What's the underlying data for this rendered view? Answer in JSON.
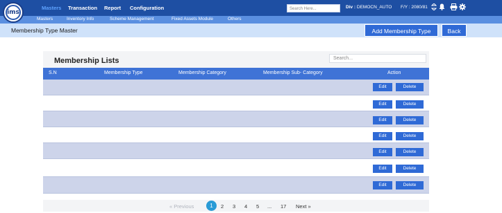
{
  "brand": {
    "logo_text": "ims"
  },
  "top_menu": [
    {
      "label": "Masters"
    },
    {
      "label": "Transaction"
    },
    {
      "label": "Report"
    },
    {
      "label": "Configuration"
    }
  ],
  "header": {
    "search_placeholder": "Search Here...",
    "div_label": "Div :",
    "div_value": "DEMOCN_AUTO",
    "fy_label": "F/Y :",
    "fy_value": "2080/81"
  },
  "sub_menu": [
    {
      "label": "Masters"
    },
    {
      "label": "Inventory Info"
    },
    {
      "label": "Scheme Management"
    },
    {
      "label": "Fixed Assets Module"
    },
    {
      "label": "Others"
    }
  ],
  "page": {
    "title": "Membership Type Master",
    "add_button": "Add Membership Type",
    "back_button": "Back"
  },
  "card": {
    "title": "Membership Lists",
    "search_placeholder": "Search..."
  },
  "table": {
    "columns": [
      "S.N",
      "Membership Type",
      "Membership Category",
      "Membership Sub- Category",
      "Action"
    ],
    "rows": [
      {
        "edit": "Edit",
        "delete": "Delete"
      },
      {
        "edit": "Edit",
        "delete": "Delete"
      },
      {
        "edit": "Edit",
        "delete": "Delete"
      },
      {
        "edit": "Edit",
        "delete": "Delete"
      },
      {
        "edit": "Edit",
        "delete": "Delete"
      },
      {
        "edit": "Edit",
        "delete": "Delete"
      },
      {
        "edit": "Edit",
        "delete": "Delete"
      }
    ]
  },
  "pagination": {
    "previous": "« Previous",
    "current": "1",
    "pages": [
      "2",
      "3",
      "4",
      "5"
    ],
    "ellipsis": "...",
    "last": "17",
    "next": "Next »"
  },
  "colors": {
    "topbar": "#1e4fa3",
    "submenu": "#5a8fe0",
    "titlebar": "#cfe2fa",
    "accent": "#2f6ad6",
    "table_header": "#3f73d6",
    "row_alt": "#cdd4ea",
    "page_current": "#2a9bd6"
  },
  "icons": [
    "refresh-icon",
    "bell-icon",
    "printer-icon",
    "gear-icon"
  ]
}
